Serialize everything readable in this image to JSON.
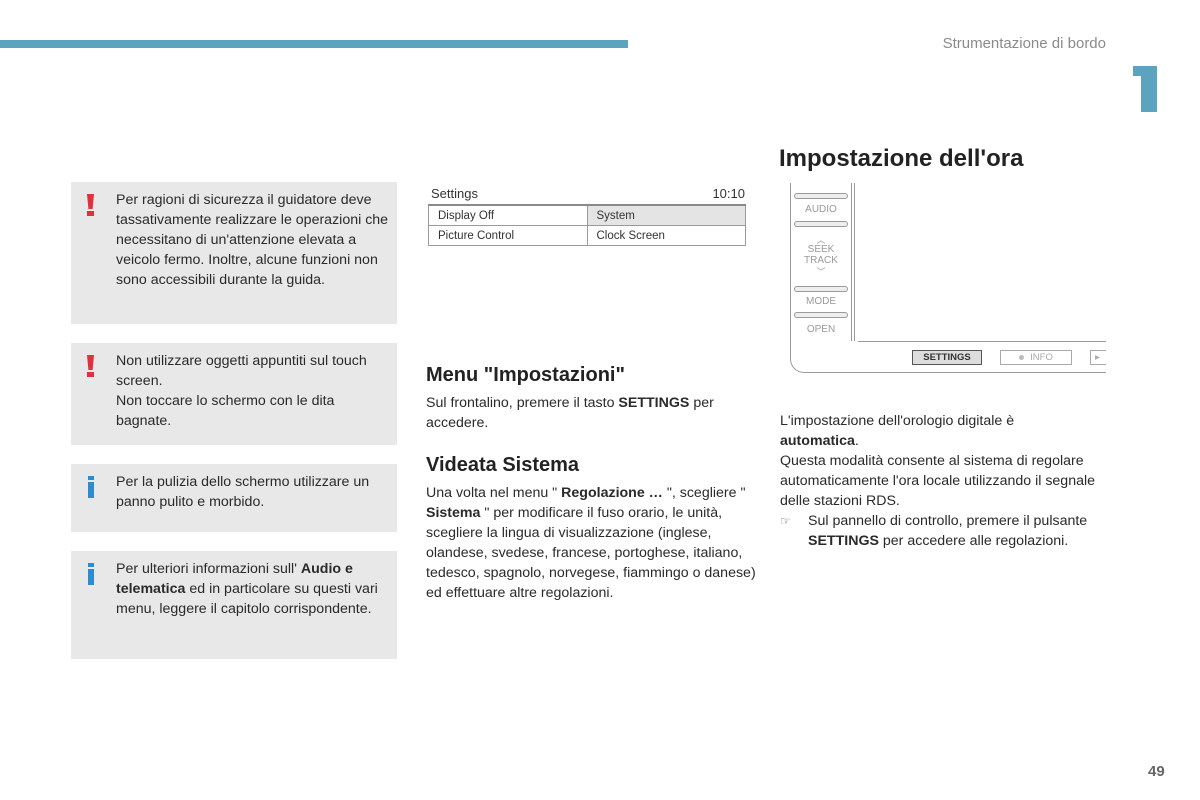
{
  "header": {
    "section_title": "Strumentazione di bordo",
    "chapter_number": "1",
    "accent_color": "#5ba3bf"
  },
  "notes": [
    {
      "type": "warning",
      "icon": "exclamation-icon",
      "color": "#e0323c",
      "text": "Per ragioni di sicurezza il guidatore deve tassativamente realizzare le operazioni che necessitano di un'attenzione elevata a veicolo fermo. Inoltre, alcune funzioni non sono accessibili durante la guida."
    },
    {
      "type": "warning",
      "icon": "exclamation-icon",
      "color": "#e0323c",
      "line1": "Non utilizzare oggetti appuntiti sul touch screen.",
      "line2": "Non toccare lo schermo con le dita bagnate."
    },
    {
      "type": "info",
      "icon": "info-icon",
      "color": "#2c8ccf",
      "text": "Per la pulizia dello schermo utilizzare un panno pulito e morbido."
    },
    {
      "type": "info",
      "icon": "info-icon",
      "color": "#2c8ccf",
      "pre": "Per ulteriori informazioni sull' ",
      "bold": "Audio e telematica",
      "post": " ed in particolare su questi vari menu, leggere il capitolo corrispondente."
    }
  ],
  "settings_screen": {
    "title": "Settings",
    "time": "10:10",
    "cells": [
      [
        "Display Off",
        "System"
      ],
      [
        "Picture Control",
        "Clock Screen"
      ]
    ],
    "selected": "System"
  },
  "menu_section": {
    "heading": "Menu \"Impostazioni\"",
    "pre": "Sul frontalino, premere il tasto ",
    "bold": "SETTINGS",
    "post": " per accedere."
  },
  "videata_section": {
    "heading": "Videata Sistema",
    "t1": "Una volta nel menu \" ",
    "b1": "Regolazione …",
    "t2": " \", scegliere \" ",
    "b2": "Sistema",
    "t3": " \" per modificare il fuso orario, le unità, scegliere la lingua di visualizzazione (inglese, olandese, svedese, francese, portoghese, italiano, tedesco, spagnolo, norvegese, fiammingo o danese) ed effettuare altre regolazioni."
  },
  "ora_section": {
    "heading": "Impostazione dell'ora",
    "t1": "L'impostazione dell'orologio digitale è ",
    "b1": "automatica",
    "t2": ".",
    "t3": "Questa modalità consente al sistema di regolare automaticamente l'ora locale utilizzando il segnale delle stazioni RDS.",
    "bullet_icon": "☞",
    "bullet_pre": "Sul pannello di controllo, premere il pulsante ",
    "bullet_bold": "SETTINGS",
    "bullet_post": " per accedere alle regolazioni."
  },
  "panel": {
    "side_buttons": [
      "AUDIO",
      "SEEK",
      "TRACK",
      "MODE",
      "OPEN"
    ],
    "bottom_buttons": [
      "SETTINGS",
      "INFO"
    ],
    "chev_up": "︿",
    "chev_down": "﹀"
  },
  "footer": {
    "page_number": "49"
  }
}
